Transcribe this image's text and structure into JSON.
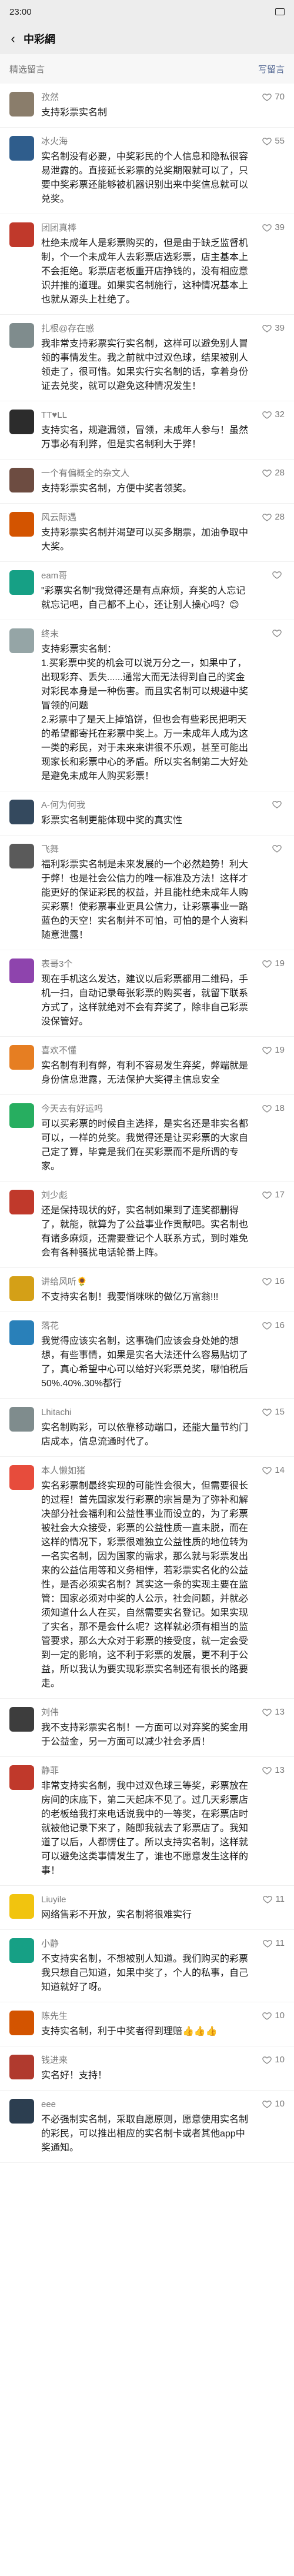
{
  "status": {
    "time": "23:00"
  },
  "nav": {
    "title": "中彩網",
    "back_glyph": "‹"
  },
  "section": {
    "title": "精选留言",
    "write_label": "写留言"
  },
  "comments": [
    {
      "name": "孜然",
      "likes": "70",
      "text": "支持彩票实名制",
      "color": "#8a7d6b"
    },
    {
      "name": "冰火海",
      "likes": "55",
      "text": "实名制没有必要，中奖彩民的个人信息和隐私很容易泄露的。直接延长彩票的兑奖期限就可以了，只要中奖彩票还能够被机器识别出来中奖信息就可以兑奖。",
      "color": "#2f5d8c"
    },
    {
      "name": "团团真棒",
      "likes": "39",
      "text": "杜绝未成年人是彩票购买的，但是由于缺乏监督机制，个一个未成年人去彩票店选彩票，店主基本上不会拒绝。彩票店老板重开店挣钱的，没有相应意识并推的道理。如果实名制施行，这种情况基本上也就从源头上杜绝了。",
      "color": "#c0392b"
    },
    {
      "name": "扎根@存在感",
      "likes": "39",
      "text": "我非常支持彩票实行实名制，这样可以避免别人冒领的事情发生。我之前就中过双色球，结果被别人领走了，很可惜。如果实行实名制的话，拿着身份证去兑奖，就可以避免这种情况发生！",
      "color": "#7f8c8d"
    },
    {
      "name": "TT♥LL",
      "likes": "32",
      "text": "支持实名，规避漏领，冒领，未成年人参与！虽然万事必有利弊，但是实名制利大于弊！",
      "color": "#2c2c2c"
    },
    {
      "name": "一个有偏概全的杂文人",
      "likes": "28",
      "text": "支持彩票实名制，方便中奖者领奖。",
      "color": "#6d4c41"
    },
    {
      "name": "风云际遇",
      "likes": "28",
      "text": "支持彩票实名制并渴望可以买多期票，加油争取中大奖。",
      "color": "#d35400"
    },
    {
      "name": "eam哥",
      "likes": "",
      "text": "\"彩票实名制\"我觉得还是有点麻烦，弃奖的人忘记就忘记吧，自己都不上心，还让别人操心吗？😊",
      "color": "#16a085"
    },
    {
      "name": "终末",
      "likes": "",
      "text": "支持彩票实名制：\n1.买彩票中奖的机会可以说万分之一，如果中了，出现彩弃、丢失......通常大而无法得到自己的奖金对彩民本身是一种伤害。而且实名制可以规避中奖冒领的问题\n2.彩票中了是天上掉馅饼，但也会有些彩民把明天的希望都寄托在彩票中奖上。万一未成年人成为这一类的彩民，对于未来来讲很不乐观，甚至可能出现家长和彩票中心的矛盾。所以实名制第二大好处是避免未成年人购买彩票！",
      "color": "#95a5a6"
    },
    {
      "name": "A-何为何我",
      "likes": "",
      "text": "彩票实名制更能体现中奖的真实性",
      "color": "#34495e"
    },
    {
      "name": "飞舞",
      "likes": "",
      "text": "福利彩票实名制是未来发展的一个必然趋势！利大于弊！也是社会公信力的唯一标准及方法！这样才能更好的保证彩民的权益，并且能杜绝未成年人购买彩票！使彩票事业更具公信力，让彩票事业一路蓝色的天空！实名制并不可怕，可怕的是个人资料随意泄露！",
      "color": "#5a5a5a"
    },
    {
      "name": "表哥3个",
      "likes": "19",
      "text": "现在手机这么发达，建议以后彩票都用二维码，手机一扫，自动记录每张彩票的购买者，就留下联系方式了，这样就绝对不会有弃奖了，除非自己彩票没保管好。",
      "color": "#8e44ad"
    },
    {
      "name": "喜欢不懂",
      "likes": "19",
      "text": "实名制有利有弊，有利不容易发生弃奖，弊端就是身份信息泄露，无法保护大奖得主信息安全",
      "color": "#e67e22"
    },
    {
      "name": "今天去有好运吗",
      "likes": "18",
      "text": "可以买彩票的时候自主选择，是实名还是非实名都可以，一样的兑奖。我觉得还是让买彩票的大家自己定了算，毕竟是我们在买彩票而不是所谓的专家。",
      "color": "#27ae60"
    },
    {
      "name": "刘少彪",
      "likes": "17",
      "text": "还是保持现状的好，实名制如果到了连奖都删得了，就能，就算为了公益事业作贡献吧。实名制也有诸多麻烦，还需要登记个人联系方式，到时难免会有各种骚扰电话轮番上阵。",
      "color": "#c0392b"
    },
    {
      "name": "讲给风听🌻",
      "likes": "16",
      "text": "不支持实名制！我要悄咪咪的做亿万富翁!!!",
      "color": "#d4a017"
    },
    {
      "name": "落花",
      "likes": "16",
      "text": "我觉得应该实名制，这事确们应该会身处她的想想，有些事情，如果是实名大法还什么容易贴切了了，真心希望中心可以给好兴彩票兑奖，哪怕税后50%.40%.30%都行",
      "color": "#2980b9"
    },
    {
      "name": "Lhitachi",
      "likes": "15",
      "text": "实名制购彩，可以依靠移动端口，还能大量节约门店成本，信息流通时代了。",
      "color": "#7f8c8d"
    },
    {
      "name": "本人懒如猪",
      "likes": "14",
      "text": "实名彩票制最终实现的可能性会很大，但需要很长的过程！首先国家发行彩票的宗旨是为了弥补和解决部分社会福利和公益性事业而设立的，为了彩票被社会大众接受，彩票的公益性质一直未脱，而在这样的情况下，彩票很难独立公益性质的地位转为一名实名制，因为国家的需求，那么就与彩票发出来的公益信用等和义务相悖，若彩票实名化的公益性，是否必须实名制？其实这一条的实现主要在监管：国家必须对中奖的人公示，社会问题，并就必须知道什么人在买，自然需要实名登记。如果实现了实名，那不是会什么呢？这样就必须有相当的监管要求，那么大众对于彩票的接受度，就一定会受到一定的影响，这不利于彩票的发展，更不利于公益，所以我认为要实现彩票实名制还有很长的路要走。",
      "color": "#e74c3c"
    },
    {
      "name": "刘伟",
      "likes": "13",
      "text": "我不支持彩票实名制！一方面可以对弃奖的奖金用于公益金，另一方面可以减少社会矛盾！",
      "color": "#3d3d3d"
    },
    {
      "name": "静菲",
      "likes": "13",
      "text": "非常支持实名制，我中过双色球三等奖，彩票放在房间的床底下，第二天起床不见了。过几天彩票店的老板给我打来电话说我中的一等奖，在彩票店时就被他记录下来了，随即我就去了彩票店了。我知道了以后，人都愣住了。所以支持实名制，这样就可以避免这类事情发生了，谁也不愿意发生这样的事！",
      "color": "#c0392b"
    },
    {
      "name": "Liuyile",
      "likes": "11",
      "text": "网络售彩不开放，实名制将很难实行",
      "color": "#f1c40f"
    },
    {
      "name": "小静",
      "likes": "11",
      "text": "不支持实名制，不想被别人知道。我们购买的彩票我只想自己知道，如果中奖了，个人的私事，自己知道就好了呀。",
      "color": "#16a085"
    },
    {
      "name": "陈先生",
      "likes": "10",
      "text": "支持实名制，利于中奖者得到理赔👍👍👍",
      "color": "#d35400"
    },
    {
      "name": "钱进来",
      "likes": "10",
      "text": "实名好！支持！",
      "color": "#b03a2e"
    },
    {
      "name": "eee",
      "likes": "10",
      "text": "不必强制实名制，采取自愿原则，愿意使用实名制的彩民，可以推出相应的实名制卡或者其他app中奖通知。",
      "color": "#2c3e50"
    }
  ]
}
